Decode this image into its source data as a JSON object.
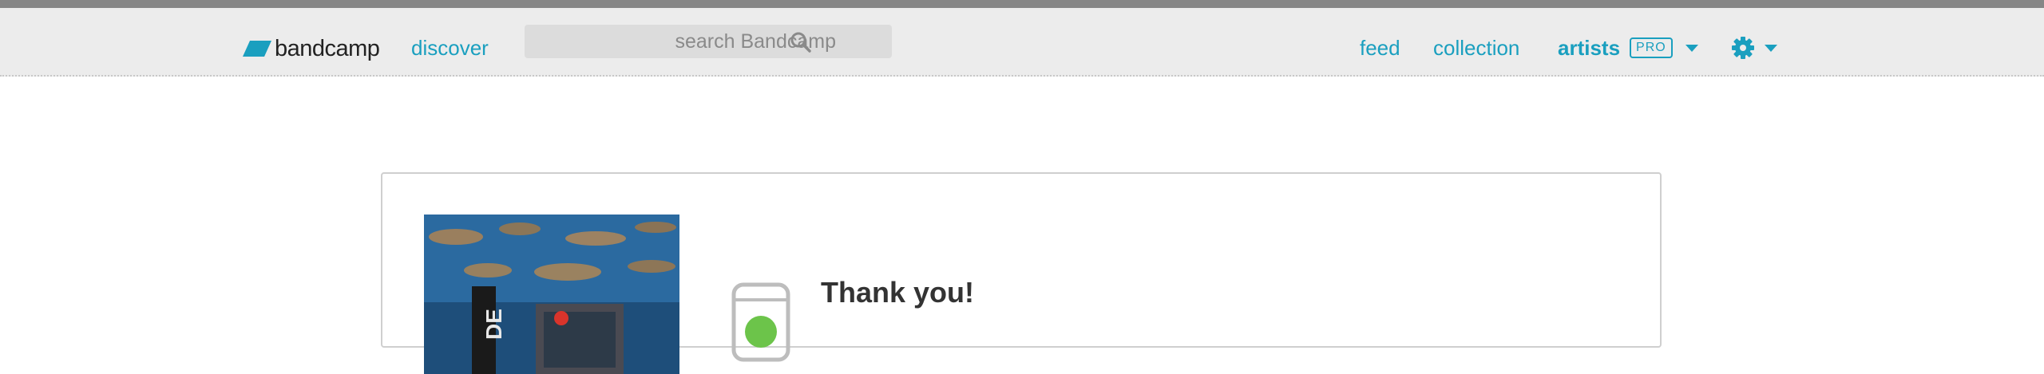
{
  "header": {
    "logo_text": "bandcamp",
    "discover_label": "discover",
    "search": {
      "placeholder": "search Bandcamp"
    },
    "nav": {
      "feed_label": "feed",
      "collection_label": "collection",
      "artists_label": "artists",
      "pro_badge": "PRO"
    },
    "icons": [
      "bandcamp-logo-icon",
      "search-icon",
      "chevron-down-icon",
      "gear-icon"
    ]
  },
  "main": {
    "card_title": "Thank you!"
  },
  "colors": {
    "accent": "#1a9fbf",
    "menubar_bg": "#ececec",
    "top_stripe": "#868686",
    "success_green": "#6cc44a",
    "heading": "#333333"
  }
}
